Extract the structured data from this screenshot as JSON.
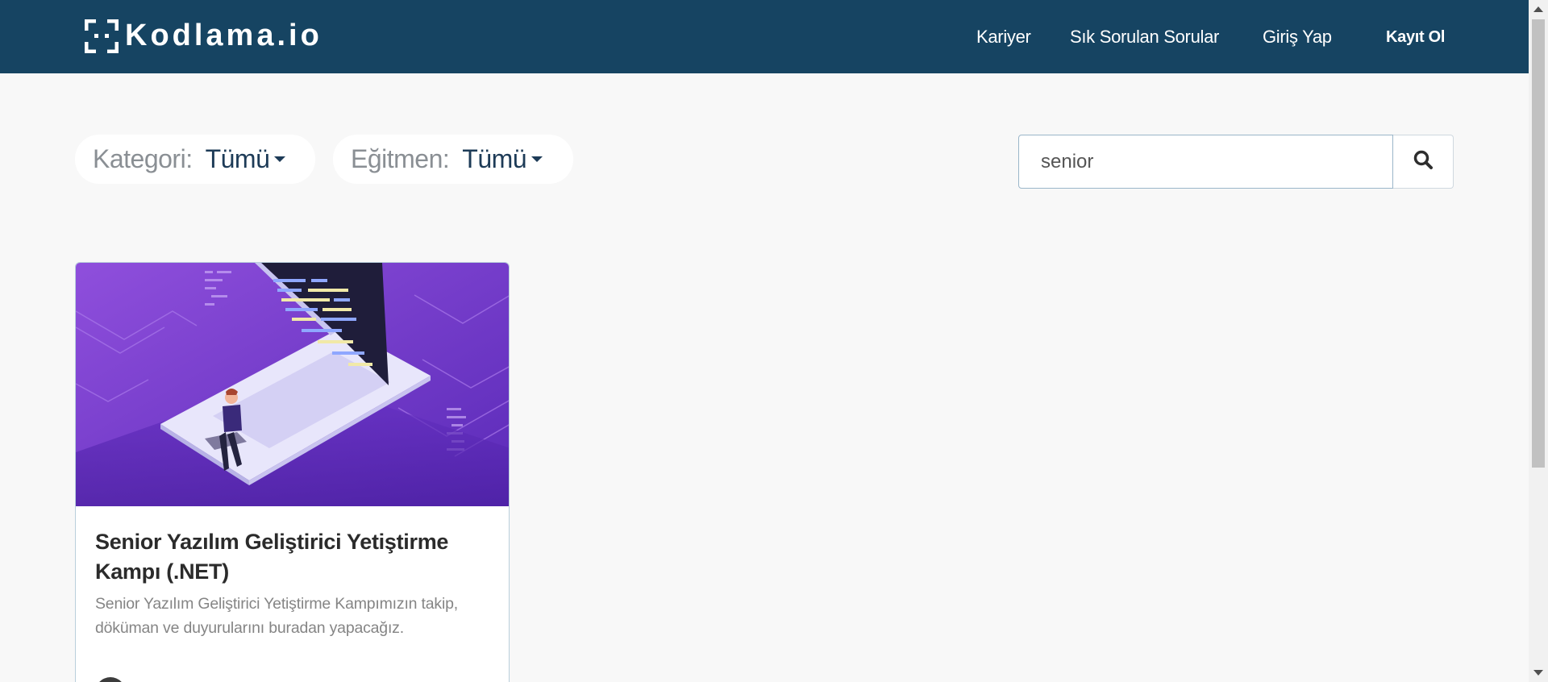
{
  "header": {
    "logo_text": "Kodlama.io",
    "nav": {
      "careers": "Kariyer",
      "faq": "Sık Sorulan Sorular",
      "login": "Giriş Yap",
      "signup": "Kayıt Ol"
    }
  },
  "filters": {
    "category": {
      "label": "Kategori:",
      "value": "Tümü"
    },
    "instructor": {
      "label": "Eğitmen:",
      "value": "Tümü"
    }
  },
  "search": {
    "value": "senior",
    "icon": "search-icon"
  },
  "courses": [
    {
      "title": "Senior Yazılım Geliştirici Yetiştirme Kampı (.NET)",
      "description": "Senior Yazılım Geliştirici Yetiştirme Kampımızın takip, döküman ve duyurularını buradan yapacağız.",
      "image": "laptop-coding-illustration"
    }
  ],
  "colors": {
    "header_bg": "#164462",
    "page_bg": "#f8f8f8",
    "accent_purple": "#7b3fd1"
  }
}
